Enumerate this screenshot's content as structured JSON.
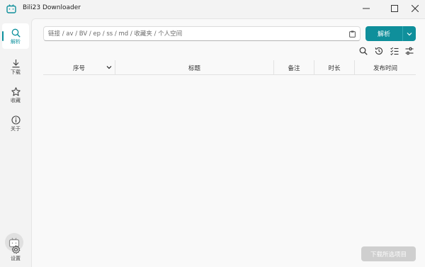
{
  "app": {
    "title": "Bili23 Downloader"
  },
  "window_controls": [
    "minimize-icon",
    "maximize-icon",
    "close-icon"
  ],
  "sidebar": {
    "items": [
      {
        "label": "解析",
        "icon": "search-icon",
        "active": true
      },
      {
        "label": "下载",
        "icon": "download-icon",
        "active": false
      },
      {
        "label": "收藏",
        "icon": "star-icon",
        "active": false
      },
      {
        "label": "关于",
        "icon": "info-icon",
        "active": false
      }
    ],
    "settings_label": "设置"
  },
  "search": {
    "placeholder": "链接 / av / BV / ep / ss / md / 收藏夹 / 个人空间",
    "value": ""
  },
  "parse_button": {
    "label": "解析"
  },
  "toolbar": [
    "search-icon",
    "history-icon",
    "list-check-icon",
    "sliders-icon"
  ],
  "table": {
    "columns": [
      "序号",
      "标题",
      "备注",
      "时长",
      "发布时间"
    ],
    "rows": []
  },
  "download_button": {
    "label": "下载所选项目",
    "enabled": false
  },
  "colors": {
    "accent": "#0f8f9b",
    "disabled": "#cfcfcf"
  }
}
